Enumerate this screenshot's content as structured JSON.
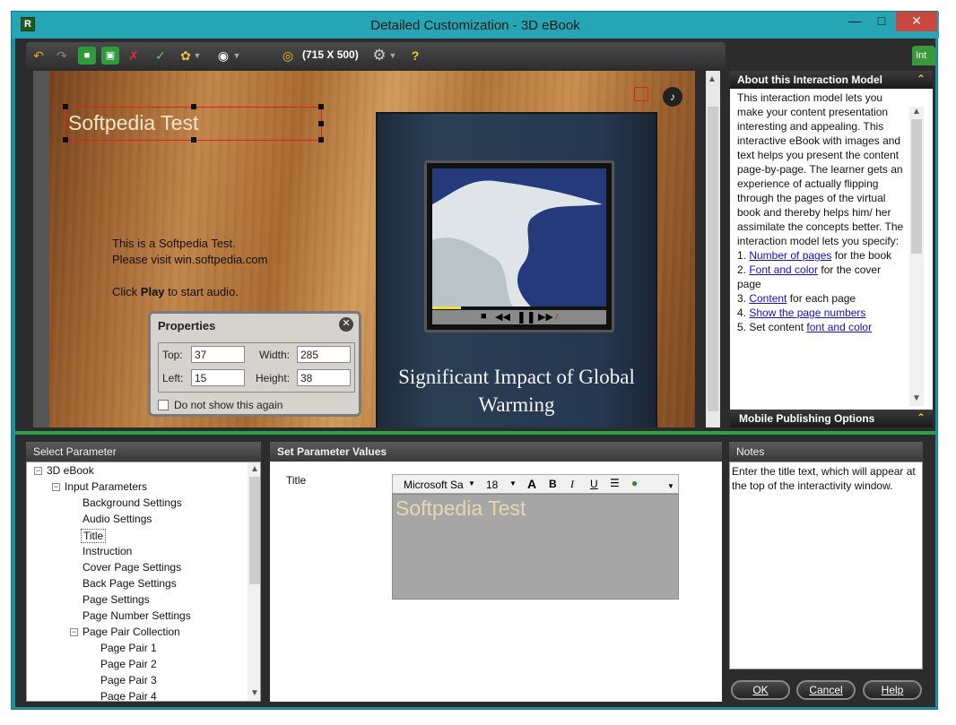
{
  "window": {
    "title": "Detailed Customization - 3D eBook",
    "app_icon": "R"
  },
  "toolbar": {
    "resolution": "(715 X 500)"
  },
  "side_tab": {
    "label": "Int"
  },
  "canvas": {
    "title_box": "Softpedia Test",
    "instruction_lines": [
      "This is a Softpedia Test.",
      "Please visit win.softpedia.com"
    ],
    "instruction_play_prefix": "Click ",
    "instruction_play_bold": "Play",
    "instruction_play_suffix": " to start audio.",
    "book_title": "Significant Impact of Global Warming"
  },
  "properties": {
    "title": "Properties",
    "top_label": "Top:",
    "top_value": "37",
    "width_label": "Width:",
    "width_value": "285",
    "left_label": "Left:",
    "left_value": "15",
    "height_label": "Height:",
    "height_value": "38",
    "checkbox_label": "Do not show this again"
  },
  "about": {
    "header": "About this Interaction Model",
    "intro": "This interaction model lets you make your content presentation interesting and appealing. This interactive eBook with images and text helps you present the content page-by-page. The learner gets an experience of actually flipping through the pages of the virtual book and thereby helps him/ her assimilate the concepts better. The interaction model lets you specify:",
    "items": [
      {
        "prefix": "1. ",
        "link": "Number of pages",
        "suffix": " for the book"
      },
      {
        "prefix": "2. ",
        "link": "Font and color",
        "suffix": " for the cover page"
      },
      {
        "prefix": "3. ",
        "link": "Content",
        "suffix": " for each page"
      },
      {
        "prefix": "4. ",
        "link": "Show the page numbers",
        "suffix": ""
      },
      {
        "prefix": "5. Set content ",
        "link": "font and color",
        "suffix": ""
      }
    ],
    "mobile_header": "Mobile Publishing Options"
  },
  "select_parameter": {
    "header": "Select Parameter",
    "root": "3D eBook",
    "input_parameters": "Input Parameters",
    "items": [
      "Background Settings",
      "Audio Settings",
      "Title",
      "Instruction",
      "Cover Page Settings",
      "Back Page Settings",
      "Page Settings",
      "Page Number Settings"
    ],
    "collection": "Page Pair Collection",
    "pairs": [
      "Page Pair  1",
      "Page Pair  2",
      "Page Pair  3",
      "Page Pair  4"
    ]
  },
  "set_values": {
    "header": "Set Parameter Values",
    "title_label": "Title",
    "font_name": "Microsoft Sa",
    "font_size": "18",
    "value": "Softpedia Test"
  },
  "notes": {
    "header": "Notes",
    "text": "Enter the title text, which will appear at the top of the interactivity window."
  },
  "buttons": {
    "ok": "OK",
    "cancel": "Cancel",
    "help": "Help"
  },
  "colors": {
    "accent": "#26a5b4",
    "divider": "#2ca14a",
    "link": "#1010cc"
  }
}
